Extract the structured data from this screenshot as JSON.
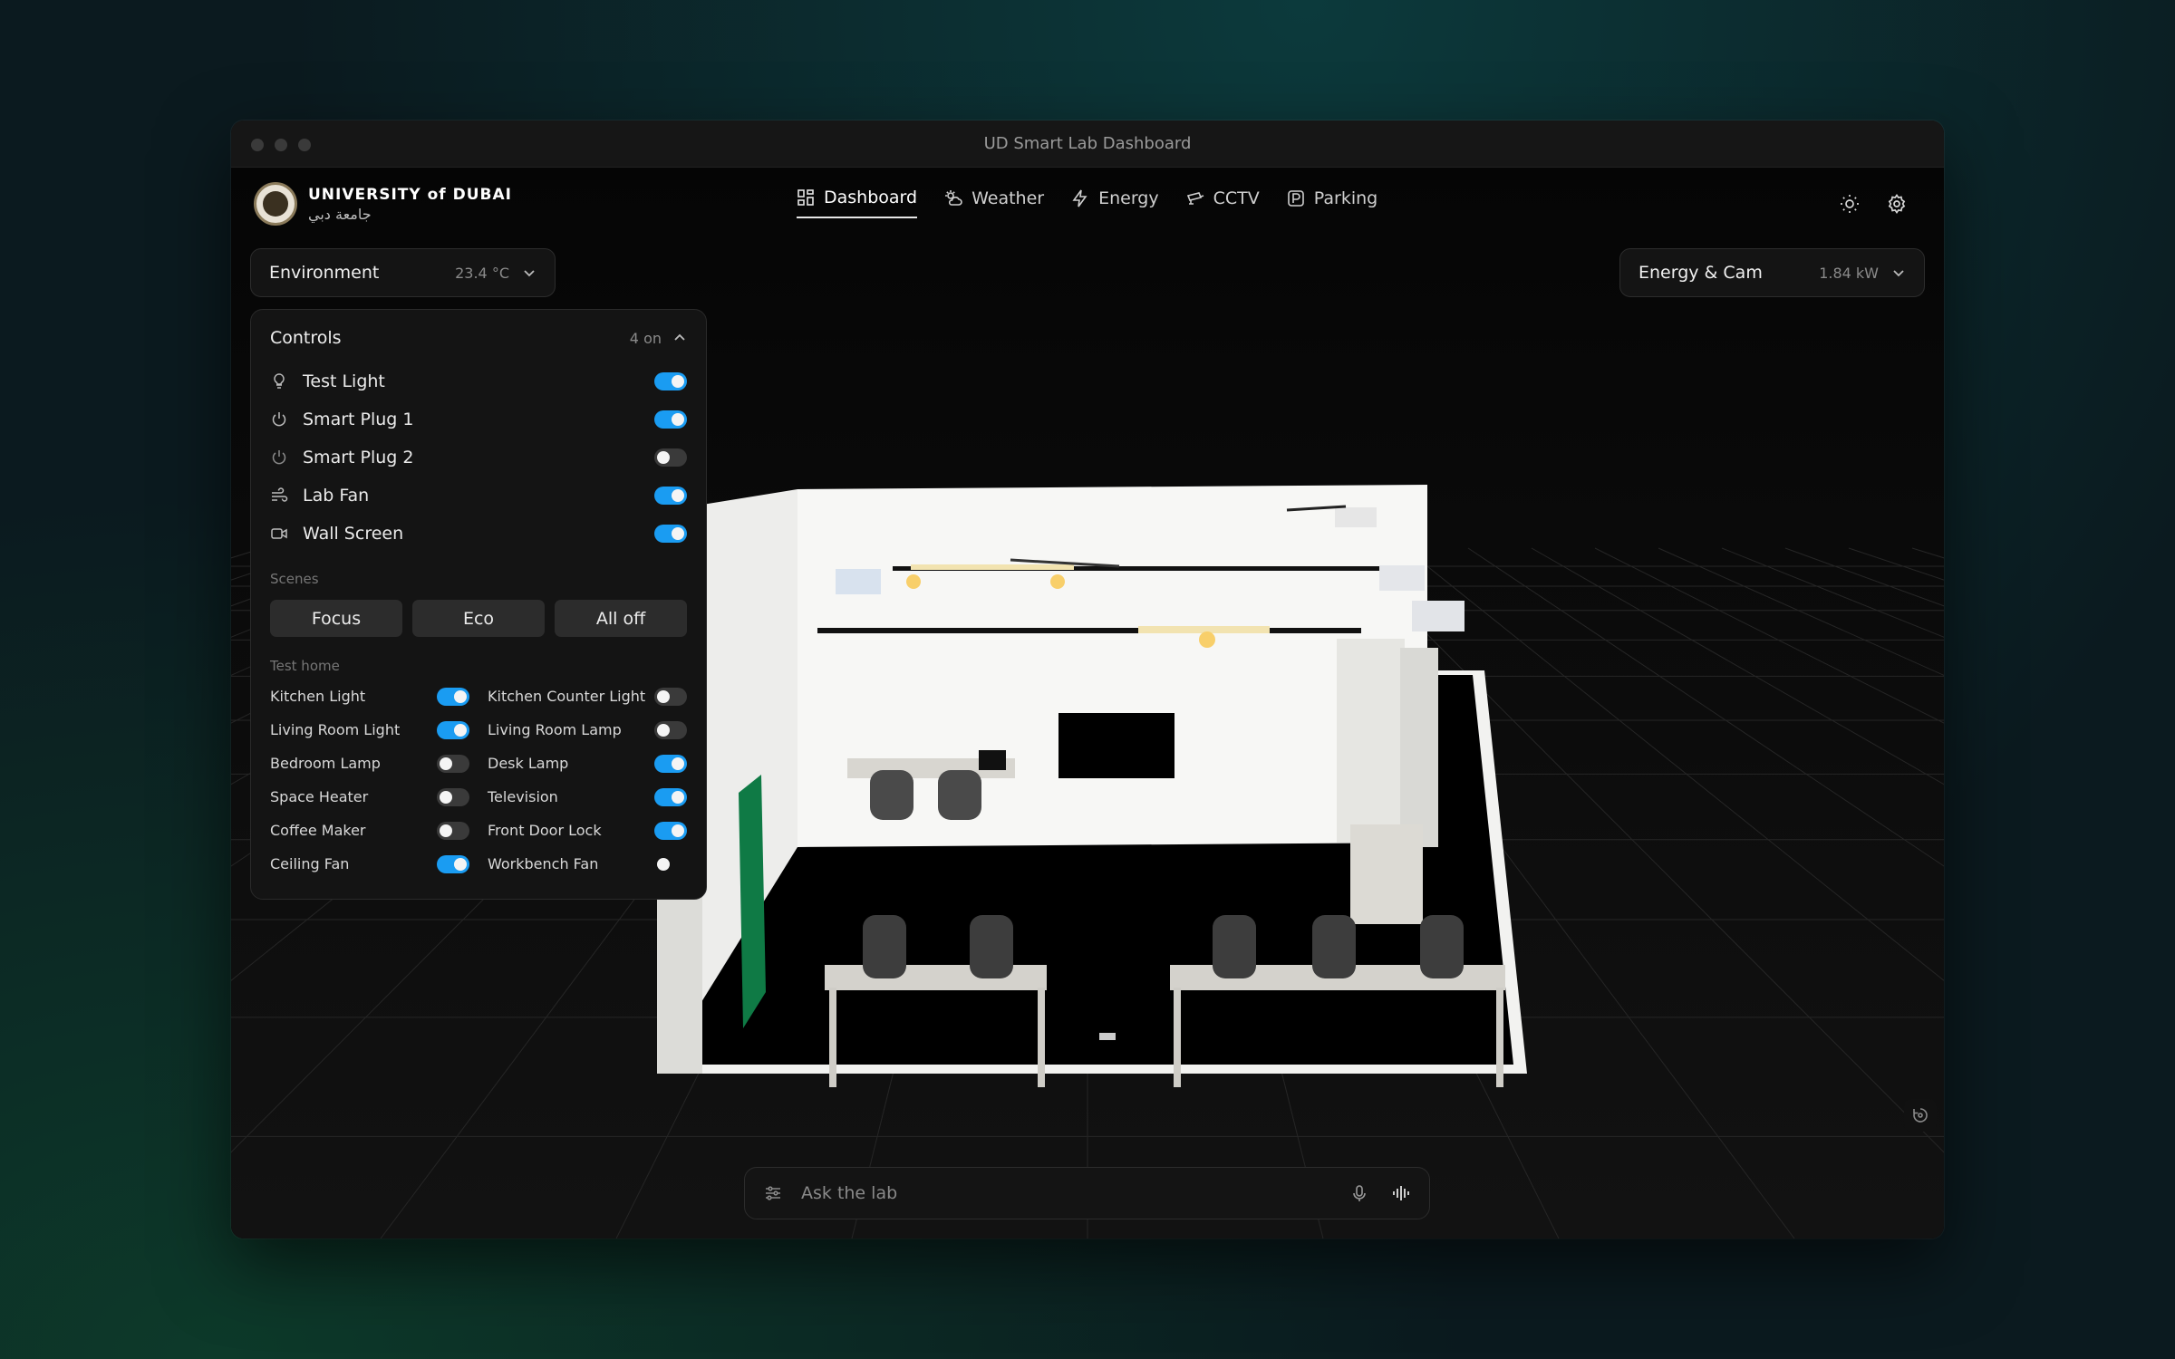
{
  "window": {
    "title": "UD Smart Lab Dashboard"
  },
  "logo": {
    "name_en": "UNIVERSITY of DUBAI",
    "name_ar": "جامعة دبي"
  },
  "nav": {
    "items": [
      {
        "label": "Dashboard",
        "icon": "grid-icon",
        "active": true
      },
      {
        "label": "Weather",
        "icon": "sun-cloud-icon",
        "active": false
      },
      {
        "label": "Energy",
        "icon": "bolt-icon",
        "active": false
      },
      {
        "label": "CCTV",
        "icon": "camera-icon",
        "active": false
      },
      {
        "label": "Parking",
        "icon": "parking-icon",
        "active": false
      }
    ]
  },
  "header_icons": [
    "sun-icon",
    "gear-icon"
  ],
  "environment": {
    "label": "Environment",
    "value": "23.4 °C"
  },
  "energy_cam": {
    "label": "Energy & Cam",
    "value": "1.84 kW"
  },
  "controls": {
    "title": "Controls",
    "count": "4 on",
    "devices": [
      {
        "name": "Test Light",
        "icon": "bulb-icon",
        "on": true
      },
      {
        "name": "Smart Plug 1",
        "icon": "power-icon",
        "on": true
      },
      {
        "name": "Smart Plug 2",
        "icon": "power-icon",
        "on": false
      },
      {
        "name": "Lab Fan",
        "icon": "wind-icon",
        "on": true
      },
      {
        "name": "Wall Screen",
        "icon": "video-icon",
        "on": true
      }
    ],
    "scenes_label": "Scenes",
    "scenes": [
      "Focus",
      "Eco",
      "All off"
    ],
    "home_label": "Test home",
    "home_devices": [
      {
        "name": "Kitchen Light",
        "on": true
      },
      {
        "name": "Kitchen Counter Light",
        "on": false
      },
      {
        "name": "Living Room Light",
        "on": true
      },
      {
        "name": "Living Room Lamp",
        "on": false
      },
      {
        "name": "Bedroom Lamp",
        "on": false
      },
      {
        "name": "Desk Lamp",
        "on": true
      },
      {
        "name": "Space Heater",
        "on": false
      },
      {
        "name": "Television",
        "on": true
      },
      {
        "name": "Coffee Maker",
        "on": false
      },
      {
        "name": "Front Door Lock",
        "on": true
      },
      {
        "name": "Ceiling Fan",
        "on": true
      },
      {
        "name": "Workbench Fan",
        "on": false
      }
    ]
  },
  "ask": {
    "placeholder": "Ask the lab"
  }
}
